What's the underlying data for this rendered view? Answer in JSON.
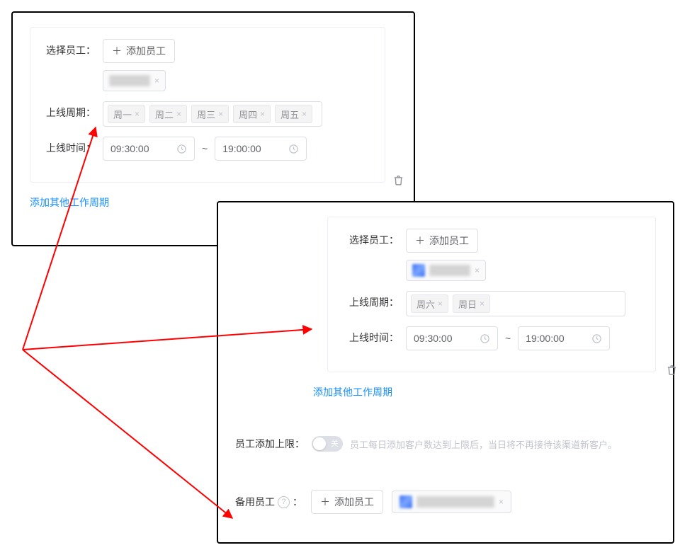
{
  "panel1": {
    "select_employee_label": "选择员工：",
    "add_employee_btn": "添加员工",
    "cycle_label": "上线周期：",
    "cycle_tags": [
      "周一",
      "周二",
      "周三",
      "周四",
      "周五"
    ],
    "time_label": "上线时间：",
    "time_start": "09:30:00",
    "time_end": "19:00:00",
    "add_other_cycle": "添加其他工作周期"
  },
  "panel2": {
    "select_employee_label": "选择员工：",
    "add_employee_btn": "添加员工",
    "cycle_label": "上线周期：",
    "cycle_tags": [
      "周六",
      "周日"
    ],
    "time_label": "上线时间：",
    "time_start": "09:30:00",
    "time_end": "19:00:00",
    "add_other_cycle": "添加其他工作周期",
    "limit_label": "员工添加上限：",
    "switch_text": "关",
    "limit_hint": "员工每日添加客户数达到上限后，当日将不再接待该渠道新客户。",
    "backup_label": "备用员工",
    "backup_add_btn": "添加员工"
  },
  "icons": {
    "close_x": "×",
    "plus": "＋",
    "tilde": "~",
    "question": "?"
  }
}
